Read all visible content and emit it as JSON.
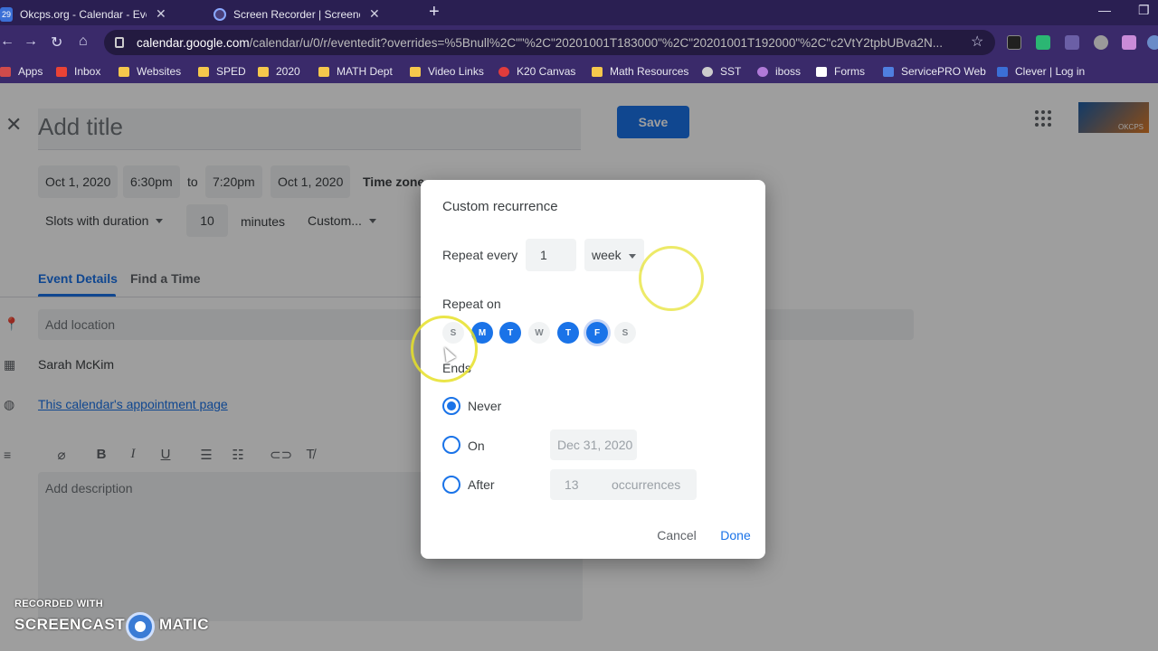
{
  "browser": {
    "tabs": [
      {
        "label": "Okcps.org - Calendar - Event det",
        "badge": "29"
      },
      {
        "label": "Screen Recorder | Screencast-O-"
      }
    ],
    "new_tab": "+",
    "url_host": "calendar.google.com",
    "url_path": "/calendar/u/0/r/eventedit?overrides=%5Bnull%2C\"\"%2C\"20201001T183000\"%2C\"20201001T192000\"%2C\"c2VtY2tpbUBva2N...",
    "bookmarks": [
      "Apps",
      "Inbox",
      "Websites",
      "SPED",
      "2020",
      "MATH Dept",
      "Video Links",
      "K20 Canvas",
      "Math Resources",
      "SST",
      "iboss",
      "Forms",
      "ServicePRO Web",
      "Clever | Log in"
    ]
  },
  "event": {
    "title_placeholder": "Add title",
    "start_date": "Oct 1, 2020",
    "start_time": "6:30pm",
    "to": "to",
    "end_time": "7:20pm",
    "end_date": "Oct 1, 2020",
    "timezone": "Time zone",
    "slots_label": "Slots with duration",
    "slot_minutes": "10",
    "minutes_label": "minutes",
    "recurrence_select": "Custom...",
    "save": "Save",
    "tabs": [
      "Event Details",
      "Find a Time"
    ],
    "location_placeholder": "Add location",
    "owner": "Sarah McKim",
    "appointment_link": "This calendar's appointment page",
    "description_placeholder": "Add description",
    "logo_text": "OKCPS"
  },
  "dialog": {
    "title": "Custom recurrence",
    "repeat_every_label": "Repeat every",
    "interval": "1",
    "unit": "week",
    "repeat_on_label": "Repeat on",
    "days": [
      {
        "letter": "S",
        "selected": false
      },
      {
        "letter": "M",
        "selected": true
      },
      {
        "letter": "T",
        "selected": true
      },
      {
        "letter": "W",
        "selected": false
      },
      {
        "letter": "T",
        "selected": true
      },
      {
        "letter": "F",
        "selected": true
      },
      {
        "letter": "S",
        "selected": false
      }
    ],
    "ends_label": "Ends",
    "never": "Never",
    "on": "On",
    "on_date": "Dec 31, 2020",
    "after": "After",
    "occurrences": "13",
    "occurrences_label": "occurrences",
    "selected_end": "Never",
    "cancel": "Cancel",
    "done": "Done"
  },
  "watermark": {
    "line1": "RECORDED WITH",
    "brand_a": "SCREENCAST",
    "brand_b": "MATIC"
  },
  "colors": {
    "accent": "#1a73e8",
    "chrome": "#3a2a6a"
  }
}
